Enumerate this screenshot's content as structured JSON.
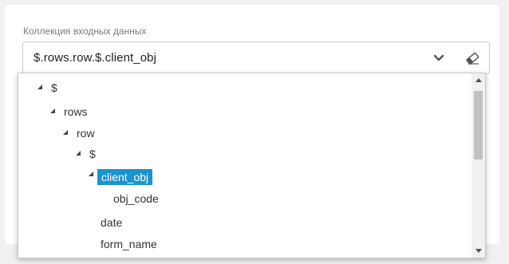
{
  "field": {
    "label": "Коллекция входных данных",
    "value": "$.rows.row.$.client_obj"
  },
  "icons": {
    "dropdown_toggle": "chevron-down-icon",
    "clear": "eraser-icon",
    "tree_expanded": "triangle-expanded-icon"
  },
  "tree": {
    "nodes": [
      {
        "label": "$",
        "expanded": true
      },
      {
        "label": "rows",
        "expanded": true
      },
      {
        "label": "row",
        "expanded": true
      },
      {
        "label": "$",
        "expanded": true
      },
      {
        "label": "client_obj",
        "expanded": true,
        "selected": true
      },
      {
        "label": "obj_code"
      },
      {
        "label": "date"
      },
      {
        "label": "form_name"
      }
    ]
  },
  "colors": {
    "selection": "#1a93cf",
    "border": "#c9c9c9",
    "background": "#f0f0f0"
  }
}
